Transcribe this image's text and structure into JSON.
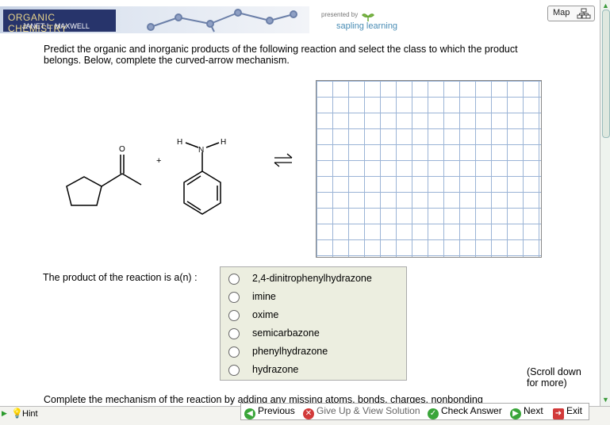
{
  "banner": {
    "course_title": "Organic Chemistry",
    "author": "Janet L. Maxwell",
    "presented_by": "presented by",
    "brand": "sapling learning"
  },
  "map_button": {
    "label": "Map",
    "icon": "sitemap-icon"
  },
  "question": {
    "prompt": "Predict the organic and inorganic products of the following reaction and select the class to which the product belongs. Below, complete the curved-arrow mechanism."
  },
  "reaction": {
    "reactant1": "cyclopentyl methyl ketone",
    "reactant2": "phenylhydrazine",
    "plus": "+",
    "equilibrium": "⇌",
    "atom_labels": {
      "o": "O",
      "n": "N",
      "h1": "H",
      "h2": "H"
    }
  },
  "product_question": {
    "label": "The product of the reaction is a(n) :",
    "options": [
      {
        "label": "2,4-dinitrophenylhydrazone",
        "selected": false
      },
      {
        "label": "imine",
        "selected": false
      },
      {
        "label": "oxime",
        "selected": false
      },
      {
        "label": "semicarbazone",
        "selected": false
      },
      {
        "label": "phenylhydrazone",
        "selected": false
      },
      {
        "label": "hydrazone",
        "selected": false
      }
    ]
  },
  "scroll_note": {
    "line1": "(Scroll down",
    "line2": "for more)"
  },
  "mechanism_text": "Complete the mechanism of the reaction by adding any missing atoms, bonds, charges, nonbonding",
  "hint": {
    "label": "Hint"
  },
  "nav": {
    "previous": "Previous",
    "give_up": "Give Up & View Solution",
    "check_answer": "Check Answer",
    "next": "Next",
    "exit": "Exit"
  },
  "colors": {
    "banner_blue": "#27346b",
    "grid_line": "#9bb4d6",
    "option_bg": "#eceee0",
    "nav_green": "#3aa53a",
    "giveup_red": "#d23a3a"
  }
}
